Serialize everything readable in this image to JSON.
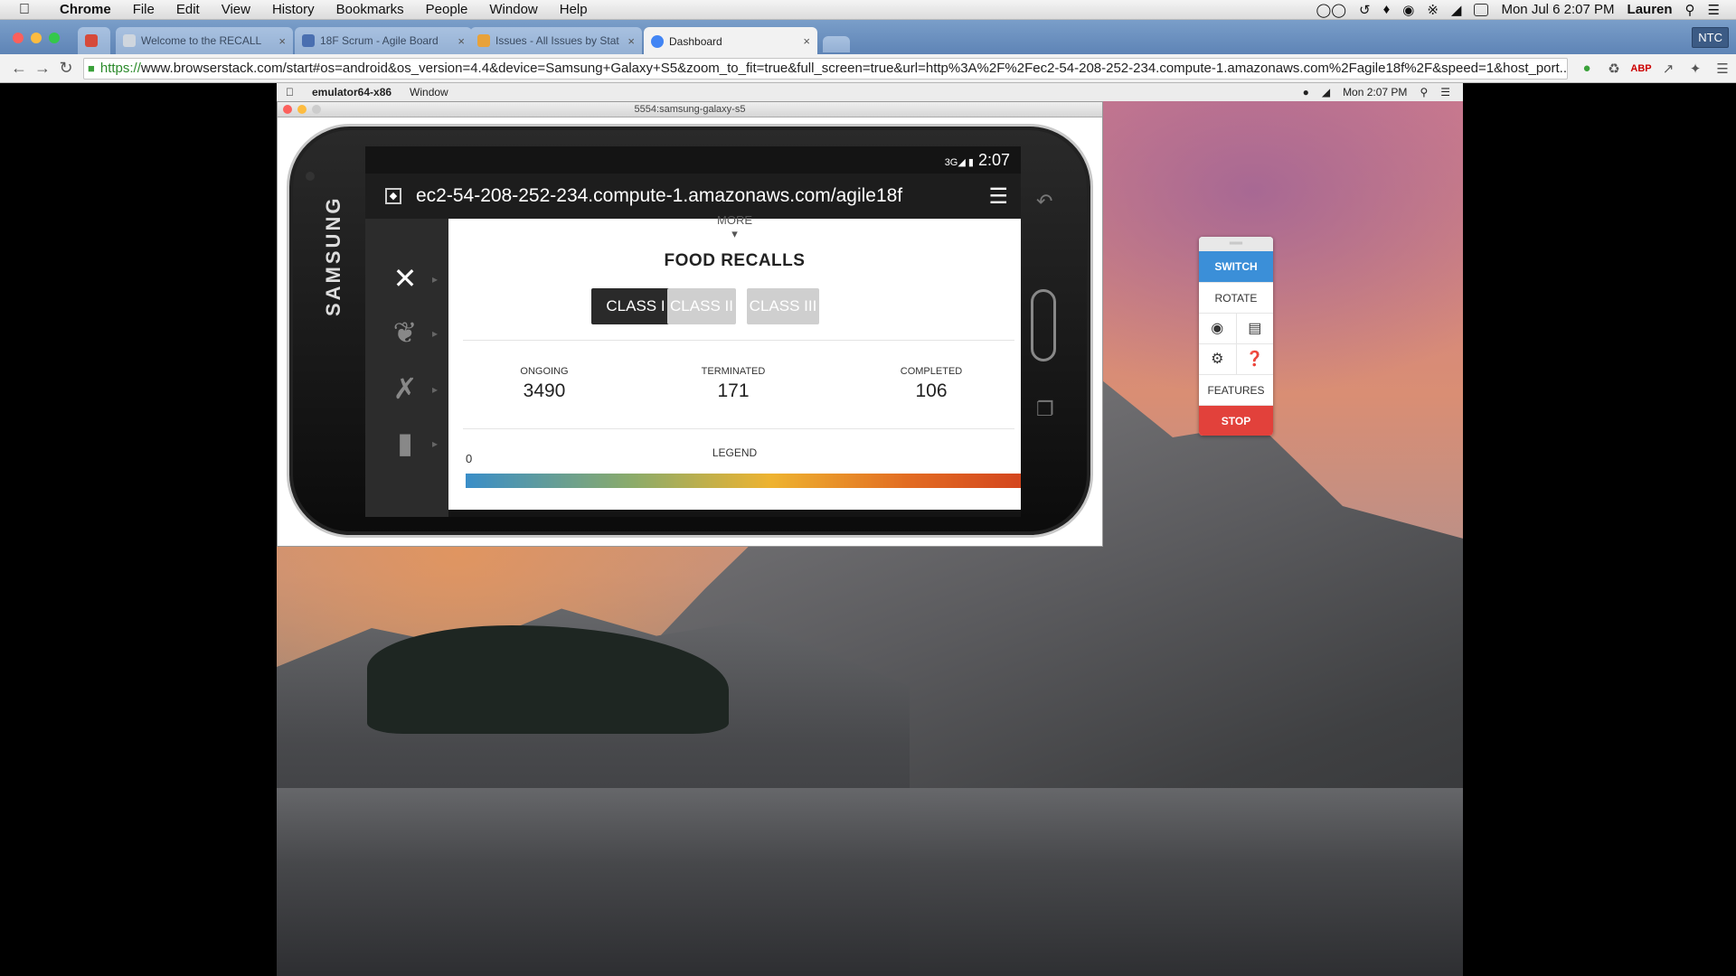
{
  "menubar": {
    "app": "Chrome",
    "items": [
      "File",
      "Edit",
      "View",
      "History",
      "Bookmarks",
      "People",
      "Window",
      "Help"
    ],
    "clock": "Mon Jul 6  2:07 PM",
    "user": "Lauren"
  },
  "tabs": [
    {
      "label": "",
      "color": "#d64a3a"
    },
    {
      "label": "Welcome to the RECALL",
      "color": "#cfd6de"
    },
    {
      "label": "18F Scrum - Agile Board",
      "color": "#4a6fb0"
    },
    {
      "label": "Issues - All Issues by Stat",
      "color": "#e8a23a"
    },
    {
      "label": "Dashboard",
      "color": "#4285f4"
    }
  ],
  "ntc_label": "NTC",
  "address": {
    "scheme": "https://",
    "rest": "www.browserstack.com/start#os=android&os_version=4.4&device=Samsung+Galaxy+S5&zoom_to_fit=true&full_screen=true&url=http%3A%2F%2Fec2-54-208-252-234.compute-1.amazonaws.com%2Fagile18f%2F&speed=1&host_port..."
  },
  "inner_menubar": {
    "app": "emulator64-x86",
    "window": "Window",
    "clock": "Mon 2:07 PM"
  },
  "emulator": {
    "title": "5554:samsung-galaxy-s5",
    "brand": "SAMSUNG",
    "status_time": "2:07",
    "url": "ec2-54-208-252-234.compute-1.amazonaws.com/agile18f"
  },
  "app": {
    "more_label": "MORE",
    "title": "FOOD RECALLS",
    "classes": [
      "CLASS I",
      "CLASS II",
      "CLASS III"
    ],
    "stats": [
      {
        "label": "ONGOING",
        "value": "3490"
      },
      {
        "label": "TERMINATED",
        "value": "171"
      },
      {
        "label": "COMPLETED",
        "value": "106"
      }
    ],
    "legend_label": "LEGEND",
    "legend_min": "0"
  },
  "bs_panel": {
    "switch": "SWITCH",
    "rotate": "ROTATE",
    "features": "FEATURES",
    "stop": "STOP"
  }
}
